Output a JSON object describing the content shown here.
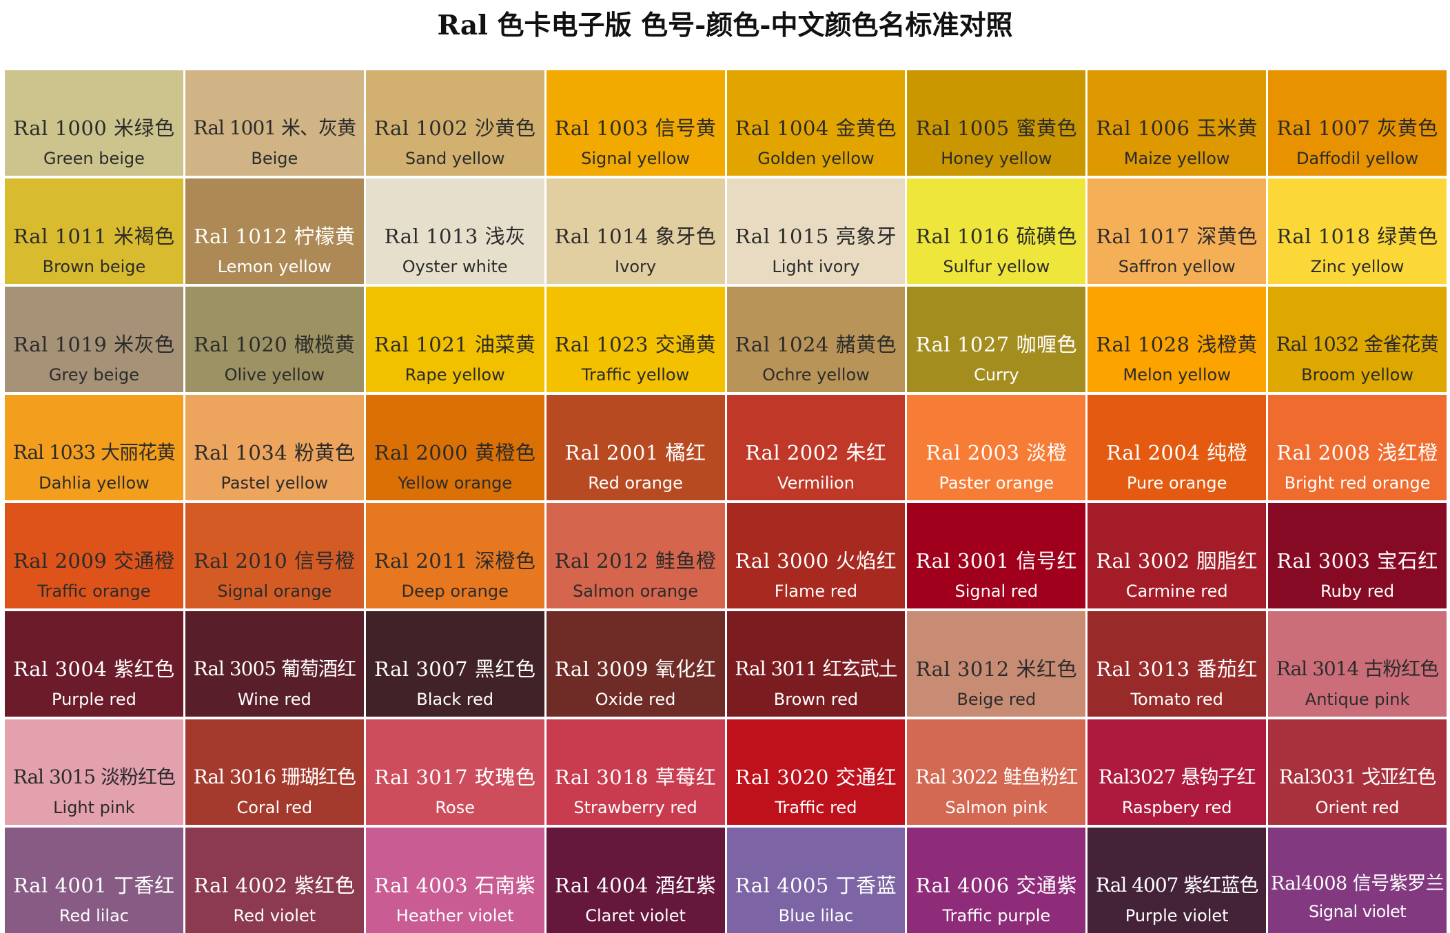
{
  "page": {
    "title": "Ral 色卡电子版  色号-颜色-中文颜色名标准对照"
  },
  "swatches": [
    {
      "code": "Ral  1000  米绿色",
      "name": "Green beige",
      "bg": "#CDC48D",
      "fg": "#2b2b2b"
    },
    {
      "code": "Ral 1001 米、灰黄",
      "name": "Beige",
      "bg": "#D0B485",
      "fg": "#2b2b2b"
    },
    {
      "code": "Ral  1002 沙黄色",
      "name": "Sand yellow",
      "bg": "#D2B06F",
      "fg": "#2b2b2b"
    },
    {
      "code": "Ral  1003 信号黄",
      "name": "Signal yellow",
      "bg": "#F2A900",
      "fg": "#2b2b2b"
    },
    {
      "code": "Ral  1004 金黄色",
      "name": "Golden yellow",
      "bg": "#E2A500",
      "fg": "#2b2b2b"
    },
    {
      "code": "Ral  1005 蜜黄色",
      "name": "Honey yellow",
      "bg": "#CA9700",
      "fg": "#2b2b2b"
    },
    {
      "code": "Ral  1006 玉米黄",
      "name": "Maize yellow",
      "bg": "#DE9800",
      "fg": "#2b2b2b"
    },
    {
      "code": "Ral  1007 灰黄色",
      "name": "Daffodil yellow",
      "bg": "#E89200",
      "fg": "#2b2b2b"
    },
    {
      "code": "Ral  1011 米褐色",
      "name": "Brown beige",
      "bg": "#D9BB2F",
      "fg": "#2b2b2b"
    },
    {
      "code": "Ral  1012 柠檬黄",
      "name": "Lemon yellow",
      "bg": "#AD8955",
      "fg": "#ffffff"
    },
    {
      "code": "Ral  1013 浅灰",
      "name": "Oyster white",
      "bg": "#E6DFCC",
      "fg": "#2b2b2b"
    },
    {
      "code": "Ral  1014 象牙色",
      "name": "Ivory",
      "bg": "#E2CFA1",
      "fg": "#2b2b2b"
    },
    {
      "code": "Ral  1015 亮象牙",
      "name": "Light ivory",
      "bg": "#E8DBC1",
      "fg": "#2b2b2b"
    },
    {
      "code": "Ral  1016 硫磺色",
      "name": "Sulfur yellow",
      "bg": "#EEE63B",
      "fg": "#2b2b2b"
    },
    {
      "code": "Ral  1017 深黄色",
      "name": "Saffron yellow",
      "bg": "#F5AF56",
      "fg": "#2b2b2b"
    },
    {
      "code": "Ral  1018 绿黄色",
      "name": "Zinc yellow",
      "bg": "#FBD838",
      "fg": "#2b2b2b"
    },
    {
      "code": "Ral  1019 米灰色",
      "name": "Grey beige",
      "bg": "#A69277",
      "fg": "#2b2b2b"
    },
    {
      "code": "Ral  1020 橄榄黄",
      "name": "Olive yellow",
      "bg": "#9C9263",
      "fg": "#2b2b2b"
    },
    {
      "code": "Ral  1021 油菜黄",
      "name": "Rape yellow",
      "bg": "#F1C100",
      "fg": "#2b2b2b"
    },
    {
      "code": "Ral  1023 交通黄",
      "name": "Traffic yellow",
      "bg": "#F3C100",
      "fg": "#2b2b2b"
    },
    {
      "code": "Ral  1024 赭黄色",
      "name": "Ochre yellow",
      "bg": "#B89458",
      "fg": "#2b2b2b"
    },
    {
      "code": "Ral  1027 咖喱色",
      "name": "Curry",
      "bg": "#A38D1E",
      "fg": "#ffffff"
    },
    {
      "code": "Ral  1028 浅橙黄",
      "name": "Melon yellow",
      "bg": "#FCA300",
      "fg": "#2b2b2b"
    },
    {
      "code": "Ral 1032 金雀花黄",
      "name": "Broom yellow",
      "bg": "#DFA800",
      "fg": "#2b2b2b"
    },
    {
      "code": "Ral 1033 大丽花黄",
      "name": "Dahlia yellow",
      "bg": "#F39E1D",
      "fg": "#2b2b2b"
    },
    {
      "code": "Ral  1034 粉黄色",
      "name": "Pastel yellow",
      "bg": "#EDA45D",
      "fg": "#2b2b2b"
    },
    {
      "code": "Ral  2000 黄橙色",
      "name": "Yellow orange",
      "bg": "#DB7004",
      "fg": "#2b2b2b"
    },
    {
      "code": "Ral  2001 橘红",
      "name": "Red orange",
      "bg": "#B84A22",
      "fg": "#ffffff"
    },
    {
      "code": "Ral  2002 朱红",
      "name": "Vermilion",
      "bg": "#C03827",
      "fg": "#ffffff"
    },
    {
      "code": "Ral  2003 淡橙",
      "name": "Paster orange",
      "bg": "#F77C35",
      "fg": "#ffffff"
    },
    {
      "code": "Ral  2004 纯橙",
      "name": "Pure orange",
      "bg": "#E35A10",
      "fg": "#ffffff"
    },
    {
      "code": "Ral  2008 浅红橙",
      "name": "Bright red orange",
      "bg": "#EF6B2E",
      "fg": "#ffffff"
    },
    {
      "code": "Ral  2009 交通橙",
      "name": "Traffic orange",
      "bg": "#DE531A",
      "fg": "#2b2b2b"
    },
    {
      "code": "Ral  2010 信号橙",
      "name": "Signal orange",
      "bg": "#D55B25",
      "fg": "#2b2b2b"
    },
    {
      "code": "Ral  2011 深橙色",
      "name": "Deep orange",
      "bg": "#E8781F",
      "fg": "#2b2b2b"
    },
    {
      "code": "Ral  2012 鲑鱼橙",
      "name": "Salmon orange",
      "bg": "#D5654D",
      "fg": "#2b2b2b"
    },
    {
      "code": "Ral  3000 火焰红",
      "name": "Flame red",
      "bg": "#A72920",
      "fg": "#ffffff"
    },
    {
      "code": "Ral  3001 信号红",
      "name": "Signal red",
      "bg": "#A0001C",
      "fg": "#ffffff"
    },
    {
      "code": "Ral  3002 胭脂红",
      "name": "Carmine red",
      "bg": "#A41C27",
      "fg": "#ffffff"
    },
    {
      "code": "Ral  3003 宝石红",
      "name": "Ruby red",
      "bg": "#870A24",
      "fg": "#ffffff"
    },
    {
      "code": "Ral  3004 紫红色",
      "name": "Purple red",
      "bg": "#6C1B2A",
      "fg": "#ffffff"
    },
    {
      "code": "Ral 3005 葡萄酒红",
      "name": "Wine red",
      "bg": "#581E29",
      "fg": "#ffffff"
    },
    {
      "code": "Ral  3007 黑红色",
      "name": "Black red",
      "bg": "#412227",
      "fg": "#ffffff"
    },
    {
      "code": "Ral  3009 氧化红",
      "name": "Oxide red",
      "bg": "#6F2C26",
      "fg": "#ffffff"
    },
    {
      "code": "Ral 3011 红玄武土",
      "name": "Brown red",
      "bg": "#7B1C20",
      "fg": "#ffffff"
    },
    {
      "code": "Ral  3012 米红色",
      "name": "Beige red",
      "bg": "#C88C75",
      "fg": "#2b2b2b"
    },
    {
      "code": "Ral  3013 番茄红",
      "name": "Tomato red",
      "bg": "#982A2A",
      "fg": "#ffffff"
    },
    {
      "code": "Ral 3014 古粉红色",
      "name": "Antique pink",
      "bg": "#CC6E79",
      "fg": "#2b2b2b"
    },
    {
      "code": "Ral 3015 淡粉红色",
      "name": "Light pink",
      "bg": "#E3A1AE",
      "fg": "#2b2b2b"
    },
    {
      "code": "Ral 3016 珊瑚红色",
      "name": "Coral red",
      "bg": "#A43A2D",
      "fg": "#ffffff"
    },
    {
      "code": "Ral  3017 玫瑰色",
      "name": "Rose",
      "bg": "#CE4D5C",
      "fg": "#ffffff"
    },
    {
      "code": "Ral  3018 草莓红",
      "name": "Strawberry red",
      "bg": "#C93B4F",
      "fg": "#ffffff"
    },
    {
      "code": "Ral  3020 交通红",
      "name": "Traffic red",
      "bg": "#BF111B",
      "fg": "#ffffff"
    },
    {
      "code": "Ral 3022 鲑鱼粉红",
      "name": "Salmon pink",
      "bg": "#D36953",
      "fg": "#ffffff"
    },
    {
      "code": "Ral3027 悬钩子红",
      "name": "Raspbery red",
      "bg": "#AD1A3D",
      "fg": "#ffffff"
    },
    {
      "code": "Ral3031 戈亚红色",
      "name": "Orient red",
      "bg": "#A8313D",
      "fg": "#ffffff"
    },
    {
      "code": "Ral  4001 丁香红",
      "name": "Red lilac",
      "bg": "#875B84",
      "fg": "#ffffff"
    },
    {
      "code": "Ral  4002 紫红色",
      "name": "Red violet",
      "bg": "#8C3A4F",
      "fg": "#ffffff"
    },
    {
      "code": "Ral  4003 石南紫",
      "name": "Heather violet",
      "bg": "#C95C93",
      "fg": "#ffffff"
    },
    {
      "code": "Ral  4004 酒红紫",
      "name": "Claret violet",
      "bg": "#65173C",
      "fg": "#ffffff"
    },
    {
      "code": "Ral  4005 丁香蓝",
      "name": "Blue lilac",
      "bg": "#7C64A5",
      "fg": "#ffffff"
    },
    {
      "code": "Ral  4006 交通紫",
      "name": "Traffic purple",
      "bg": "#8E2C79",
      "fg": "#ffffff"
    },
    {
      "code": "Ral 4007 紫红蓝色",
      "name": "Purple violet",
      "bg": "#442338",
      "fg": "#ffffff"
    },
    {
      "code": "Ral4008 信号紫罗兰",
      "name": "Signal violet",
      "bg": "#82397F",
      "fg": "#ffffff"
    }
  ]
}
